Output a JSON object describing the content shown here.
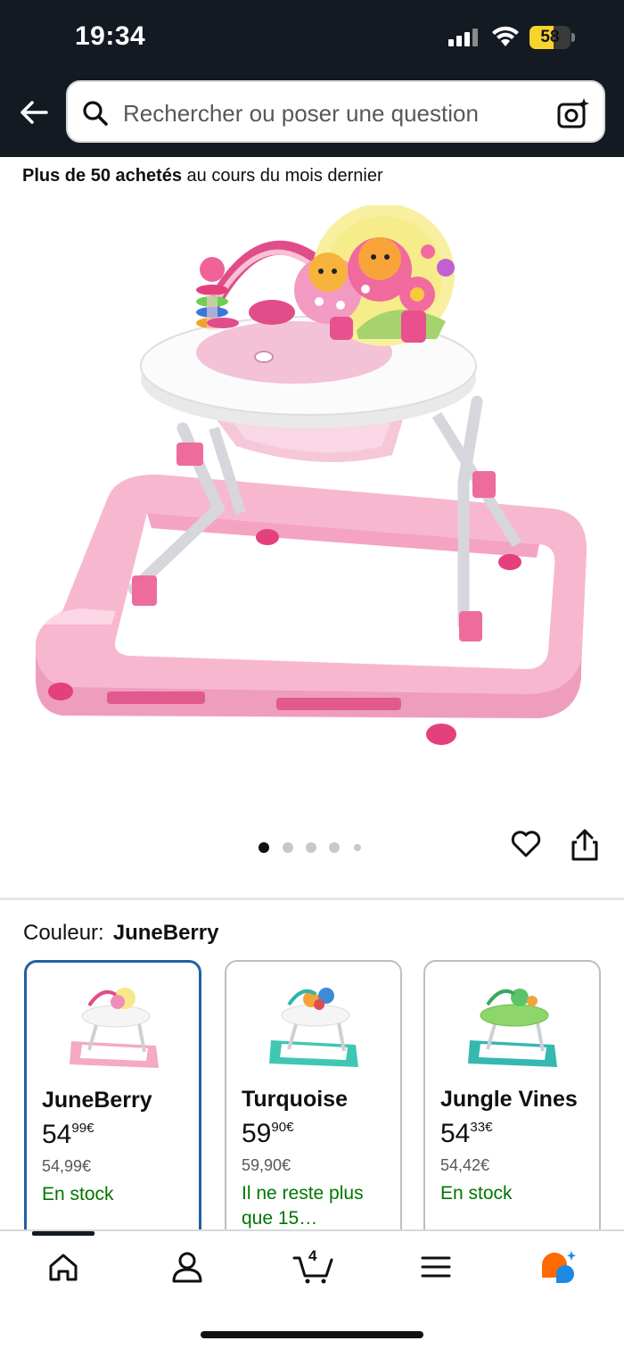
{
  "status_bar": {
    "time": "19:34",
    "battery_level": "58",
    "battery_percent": 58
  },
  "header": {
    "search_placeholder": "Rechercher ou poser une question",
    "icons": [
      "back-arrow-icon",
      "search-icon",
      "camera-search-icon"
    ]
  },
  "product": {
    "bought_bold": "Plus de 50 achetés",
    "bought_rest": " au cours du mois dernier",
    "gallery": {
      "current_image": 1,
      "total_dots": 5
    }
  },
  "color_selector": {
    "label": "Couleur:",
    "selected": "JuneBerry",
    "options": [
      {
        "name": "JuneBerry",
        "price_whole": "54",
        "price_fraction": "99",
        "currency": "€",
        "unit_price": "54,99€",
        "stock": "En stock",
        "selected": true,
        "accent": "#f2a7c3"
      },
      {
        "name": "Turquoise",
        "price_whole": "59",
        "price_fraction": "90",
        "currency": "€",
        "unit_price": "59,90€",
        "stock": "Il ne reste plus que 15…",
        "selected": false,
        "accent": "#3fc7b3"
      },
      {
        "name": "Jungle Vines",
        "price_whole": "54",
        "price_fraction": "33",
        "currency": "€",
        "unit_price": "54,42€",
        "stock": "En stock",
        "selected": false,
        "accent": "#35b8b0"
      }
    ]
  },
  "bottom_nav": {
    "items": [
      "home-icon",
      "account-icon",
      "cart-icon",
      "menu-icon",
      "rufus-ai-icon"
    ],
    "cart_count": "4",
    "active": "home-icon"
  },
  "colors": {
    "header_bg": "#131a22",
    "selected_border": "#2162a1",
    "stock_green": "#007600",
    "product_pink": "#f7bcd3"
  }
}
